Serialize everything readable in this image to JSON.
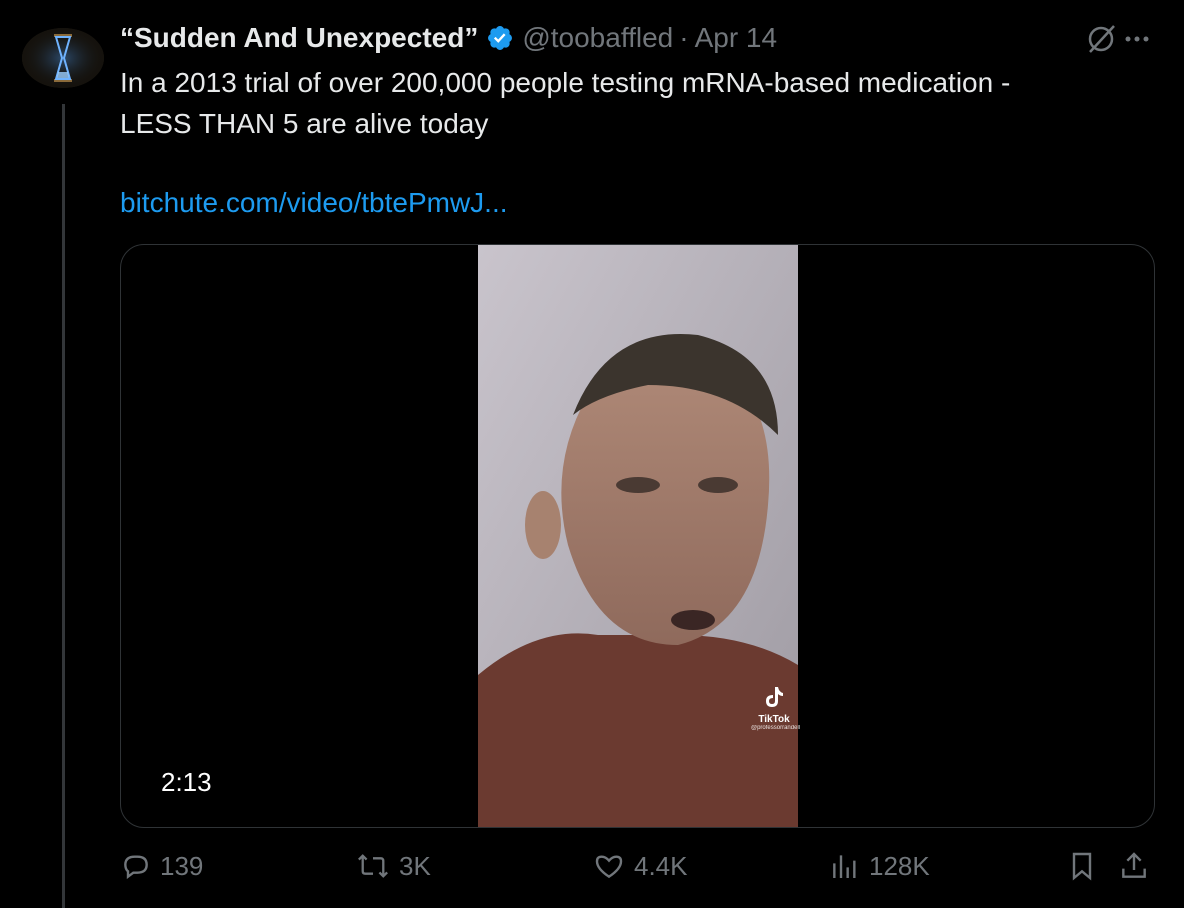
{
  "tweet": {
    "display_name": "“Sudden And Unexpected”",
    "handle": "@toobaffled",
    "separator": "·",
    "date": "Apr 14",
    "text_line1": "In a 2013 trial of over 200,000 people testing mRNA-based medication -",
    "text_line2": "LESS THAN 5 are alive today",
    "link": "bitchute.com/video/tbtePmwJ..."
  },
  "media": {
    "duration": "2:13",
    "watermark_label": "TikTok",
    "watermark_user": "@professorrandell"
  },
  "actions": {
    "replies": "139",
    "reposts": "3K",
    "likes": "4.4K",
    "views": "128K"
  },
  "icons": {
    "verified": "verified-badge-icon",
    "grok": "grok-icon",
    "more": "more-icon",
    "reply": "reply-icon",
    "repost": "repost-icon",
    "like": "heart-icon",
    "views": "views-icon",
    "bookmark": "bookmark-icon",
    "share": "share-icon"
  },
  "colors": {
    "background": "#000000",
    "text": "#e7e9ea",
    "muted": "#71767b",
    "link": "#1d9bf0",
    "verified": "#1d9bf0"
  }
}
